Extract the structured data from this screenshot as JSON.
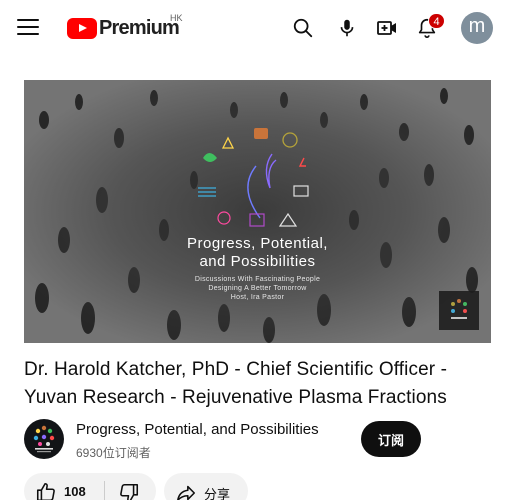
{
  "header": {
    "logo_text": "Premium",
    "region": "HK",
    "notification_count": "4",
    "avatar_letter": "m"
  },
  "video": {
    "card_title_line1": "Progress, Potential,",
    "card_title_line2": "and Possibilities",
    "card_sub_line1": "Discussions With Fascinating People",
    "card_sub_line2": "Designing A Better Tomorrow",
    "card_sub_line3": "Host, Ira Pastor"
  },
  "title": {
    "line1": "Dr. Harold Katcher, PhD - Chief Scientific Officer -",
    "line2": "Yuvan Research - Rejuvenative Plasma Fractions"
  },
  "channel": {
    "name": "Progress, Potential, and Possibilities",
    "subscribers": "6930位订阅者",
    "subscribe_label": "订阅"
  },
  "actions": {
    "like_count": "108",
    "share_label": "分享"
  },
  "colors": {
    "brand_red": "#ff0000",
    "badge_red": "#cc0000",
    "text_primary": "#0f0f0f",
    "text_secondary": "#606060",
    "chip_bg": "#f2f2f2"
  },
  "icons": [
    "menu-icon",
    "youtube-logo-icon",
    "search-icon",
    "mic-icon",
    "create-icon",
    "bell-icon",
    "like-icon",
    "dislike-icon",
    "share-icon"
  ]
}
